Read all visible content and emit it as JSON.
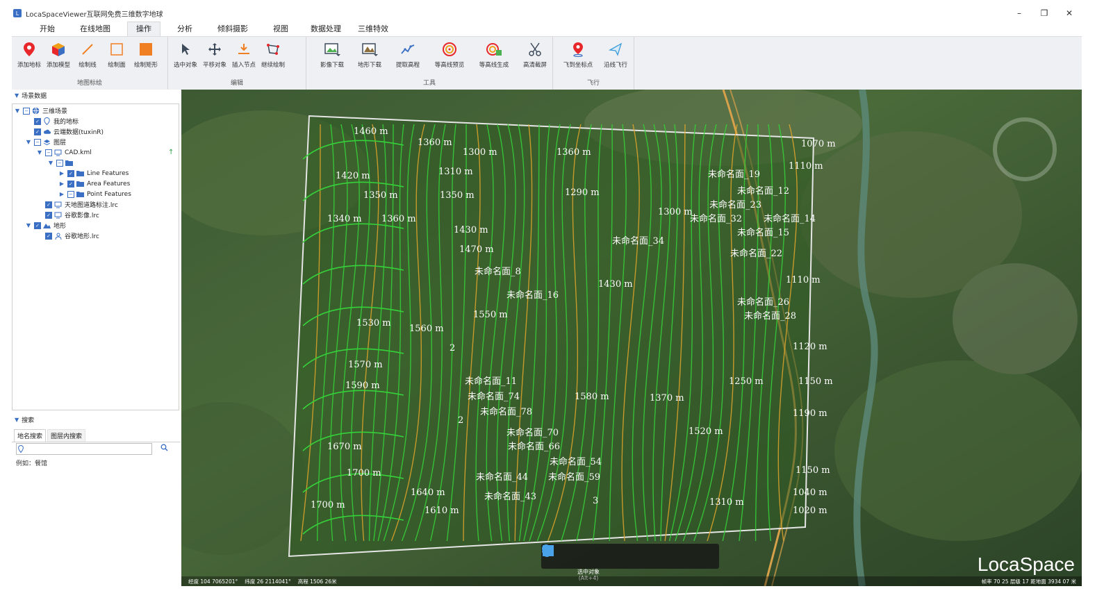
{
  "window": {
    "title": "LocaSpaceViewer互联网免费三维数字地球",
    "controls": [
      "–",
      "❐",
      "✕"
    ]
  },
  "menu": {
    "tabs": [
      "开始",
      "在线地图",
      "操作",
      "分析",
      "倾斜摄影",
      "视图",
      "数据处理",
      "三维特效"
    ],
    "active_index": 2
  },
  "ribbon": {
    "groups": [
      {
        "name": "地图标绘",
        "buttons": [
          {
            "label": "添加地标",
            "icon": "placemark-icon"
          },
          {
            "label": "添加模型",
            "icon": "cube-icon"
          },
          {
            "label": "绘制线",
            "icon": "line-icon"
          },
          {
            "label": "绘制面",
            "icon": "polygon-icon"
          },
          {
            "label": "绘制矩形",
            "icon": "rectangle-icon"
          }
        ]
      },
      {
        "name": "编辑",
        "buttons": [
          {
            "label": "选中对象",
            "icon": "pointer-icon"
          },
          {
            "label": "平移对象",
            "icon": "move-icon"
          },
          {
            "label": "插入节点",
            "icon": "insert-node-icon"
          },
          {
            "label": "继续绘制",
            "icon": "continue-draw-icon"
          }
        ]
      },
      {
        "name": "工具",
        "buttons": [
          {
            "label": "影像下载",
            "icon": "image-download-icon"
          },
          {
            "label": "地形下载",
            "icon": "terrain-download-icon"
          },
          {
            "label": "提取高程",
            "icon": "elevation-icon"
          },
          {
            "label": "等高线预览",
            "icon": "contour-preview-icon"
          },
          {
            "label": "等高线生成",
            "icon": "contour-generate-icon"
          },
          {
            "label": "高清截屏",
            "icon": "scissors-icon"
          }
        ]
      },
      {
        "name": "飞行",
        "buttons": [
          {
            "label": "飞到坐标点",
            "icon": "fly-to-point-icon"
          },
          {
            "label": "沿线飞行",
            "icon": "fly-along-line-icon"
          }
        ]
      }
    ]
  },
  "scene_panel": {
    "title": "场景数据",
    "tree": [
      {
        "label": "三维场景",
        "icon": "globe-icon"
      },
      {
        "label": "我的地标",
        "icon": "placemark-icon"
      },
      {
        "label": "云端数据(tuxinR)",
        "icon": "cloud-icon"
      },
      {
        "label": "图层",
        "icon": "layers-icon"
      },
      {
        "label": "CAD.kml",
        "icon": "monitor-icon"
      },
      {
        "label": "",
        "icon": "folder-icon"
      },
      {
        "label": "Line Features",
        "icon": "folder-icon"
      },
      {
        "label": "Area Features",
        "icon": "folder-icon"
      },
      {
        "label": "Point Features",
        "icon": "folder-icon"
      },
      {
        "label": "天地图道路标注.lrc",
        "icon": "monitor-icon"
      },
      {
        "label": "谷歌影像.lrc",
        "icon": "monitor-icon"
      },
      {
        "label": "地形",
        "icon": "terrain-icon"
      },
      {
        "label": "谷歌地形.lrc",
        "icon": "person-icon"
      }
    ]
  },
  "search_panel": {
    "title": "搜索",
    "tabs": [
      "地名搜索",
      "图层内搜索"
    ],
    "input_value": "",
    "hint": "例如：餐馆"
  },
  "map": {
    "contour_labels": [
      "1460 m",
      "1360 m",
      "1300 m",
      "1360 m",
      "1070 m",
      "1420 m",
      "1310 m",
      "1110 m",
      "1350 m",
      "1350 m",
      "1290 m",
      "1340 m",
      "1360 m",
      "1430 m",
      "1300 m",
      "1470 m",
      "1430 m",
      "1550 m",
      "1530 m",
      "1560 m",
      "1110 m",
      "1120 m",
      "1570 m",
      "1590 m",
      "1250 m",
      "1150 m",
      "1580 m",
      "1370 m",
      "1190 m",
      "1520 m",
      "1670 m",
      "1700 m",
      "1150 m",
      "1640 m",
      "1700 m",
      "1610 m",
      "1310 m",
      "1040 m",
      "1020 m"
    ],
    "feature_labels": [
      "未命名面_19",
      "未命名面_12",
      "未命名面_23",
      "未命名面_32",
      "未命名面_14",
      "未命名面_15",
      "未命名面_34",
      "未命名面_22",
      "未命名面_8",
      "未命名面_16",
      "未命名面_26",
      "未命名面_28",
      "未命名面_11",
      "未命名面_74",
      "未命名面_78",
      "未命名面_70",
      "未命名面_66",
      "未命名面_54",
      "未命名面_44",
      "未命名面_59",
      "未命名面_43",
      "2",
      "2",
      "3"
    ],
    "toolbar": {
      "buttons": [
        "hand-icon",
        "pointer-icon",
        "pin-icon",
        "line-icon",
        "rectangle-icon",
        "chart-icon"
      ],
      "tooltip_line1": "选中对象",
      "tooltip_line2": "(Alt+4)"
    },
    "brand": "LocaSpace",
    "status_left": [
      "经度 104 7065201°",
      "纬度 26 2114041°",
      "高程 1506 26米"
    ],
    "status_right": "帧率 70 25  层级 17  距地面 3934 07 米"
  },
  "colors": {
    "contour": "#35d23a",
    "contour_index": "#e0a52c",
    "panel_accent": "#3a6fc4",
    "ribbon_bg": "#eef0f3"
  }
}
